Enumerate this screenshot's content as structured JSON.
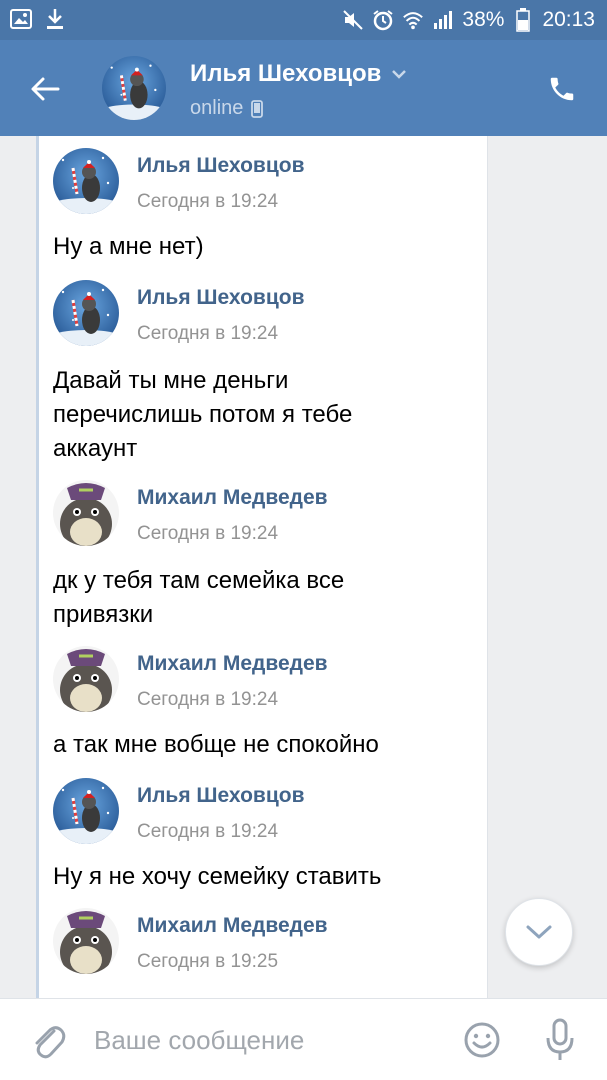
{
  "status_bar": {
    "battery": "38%",
    "time": "20:13",
    "icons": [
      "image-icon",
      "download-icon",
      "mute-icon",
      "alarm-icon",
      "wifi-icon",
      "signal-icon",
      "battery-icon"
    ]
  },
  "header": {
    "name": "Илья Шеховцов",
    "status": "online",
    "icons": [
      "back-arrow-icon",
      "chevron-down-icon",
      "phone-online-icon",
      "phone-call-icon"
    ]
  },
  "messages": [
    {
      "author": "Илья Шеховцов",
      "time": "Сегодня в 19:24",
      "text": "Ну а мне нет)",
      "avatar": "raccoon"
    },
    {
      "author": "Илья Шеховцов",
      "time": "Сегодня в 19:24",
      "text": "Давай ты мне деньги перечислишь потом я тебе аккаунт",
      "avatar": "raccoon"
    },
    {
      "author": "Михаил Медведев",
      "time": "Сегодня в 19:24",
      "text": "дк у тебя там семейка все привязки",
      "avatar": "totoro"
    },
    {
      "author": "Михаил Медведев",
      "time": "Сегодня в 19:24",
      "text": "а так мне вобще не спокойно",
      "avatar": "totoro"
    },
    {
      "author": "Илья Шеховцов",
      "time": "Сегодня в 19:24",
      "text": "Ну я не хочу семейку ставить",
      "avatar": "raccoon"
    },
    {
      "author": "Михаил Медведев",
      "time": "Сегодня в 19:25",
      "text": "",
      "avatar": "totoro"
    }
  ],
  "composer": {
    "placeholder": "Ваше сообщение",
    "value": "",
    "icons": [
      "paperclip-icon",
      "smiley-icon",
      "microphone-icon"
    ]
  },
  "colors": {
    "header_bg": "#5181b8",
    "statusbar_bg": "#4a76a8",
    "author_name": "#42648b",
    "timestamp": "#939393",
    "chat_bg": "#edeef0"
  }
}
